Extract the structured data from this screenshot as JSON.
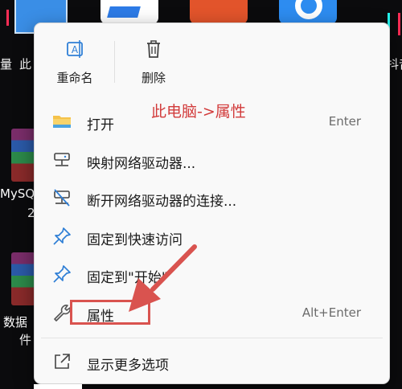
{
  "desktop": {
    "icon_label_left_top": "此",
    "icon_label_left_top2": "量",
    "icon_label_right_top": "抖音",
    "icon_label_mysql": "MySQ",
    "icon_label_mysql2": "2",
    "icon_label_data": "数据",
    "icon_label_data2": "件"
  },
  "annotation": {
    "text": "此电脑->属性"
  },
  "context_menu": {
    "quick_actions": [
      {
        "label": "重命名",
        "icon": "rename-icon"
      },
      {
        "label": "删除",
        "icon": "trash-icon"
      }
    ],
    "items": [
      {
        "label": "打开",
        "accelerator": "Enter",
        "icon": "folder-icon"
      },
      {
        "label": "映射网络驱动器...",
        "accelerator": "",
        "icon": "network-drive-icon"
      },
      {
        "label": "断开网络驱动器的连接...",
        "accelerator": "",
        "icon": "disconnect-network-drive-icon"
      },
      {
        "label": "固定到快速访问",
        "accelerator": "",
        "icon": "pin-icon"
      },
      {
        "label": "固定到\"开始\"",
        "accelerator": "",
        "icon": "pin-start-icon"
      },
      {
        "label": "属性",
        "accelerator": "Alt+Enter",
        "icon": "wrench-icon"
      },
      {
        "label": "显示更多选项",
        "accelerator": "",
        "icon": "more-options-icon"
      }
    ]
  },
  "colors": {
    "annotation": "#d9534f",
    "menu_bg": "#f9f9f9",
    "icon_accent": "#2f7fd6"
  }
}
